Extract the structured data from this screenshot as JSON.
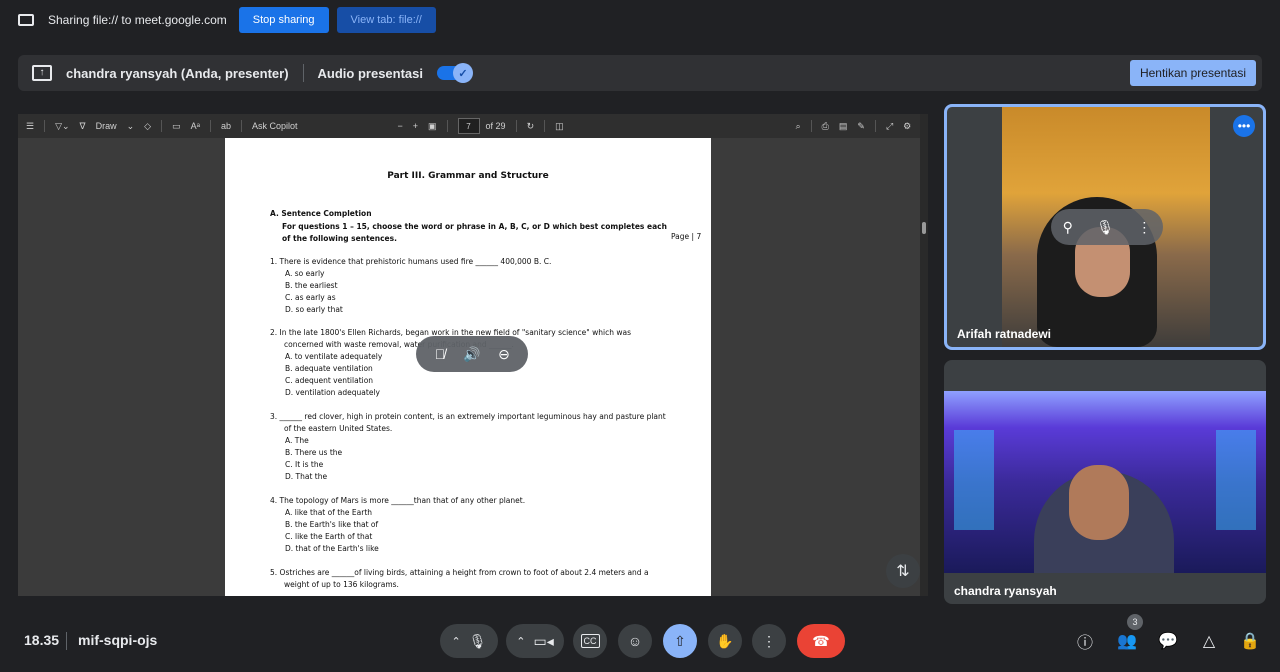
{
  "share_bar": {
    "text": "Sharing file:// to meet.google.com",
    "stop_label": "Stop sharing",
    "view_label": "View tab: file://"
  },
  "presenter_bar": {
    "presenter": "chandra ryansyah (Anda, presenter)",
    "audio_label": "Audio presentasi",
    "audio_on": true,
    "stop_label": "Hentikan presentasi"
  },
  "pdf_toolbar": {
    "draw_label": "Draw",
    "copilot_label": "Ask Copilot",
    "page_current": "7",
    "page_total": "of 29"
  },
  "pdf": {
    "part_title": "Part III.  Grammar and Structure",
    "section_title": "A. Sentence Completion",
    "instruction": "For questions 1 – 15, choose the word or phrase in A, B, C, or D which best completes each of the following sentences.",
    "page_label": "Page | 7",
    "questions": [
      {
        "stem": "1.  There is evidence that prehistoric humans used fire ______ 400,000 B. C.",
        "options": [
          "A.   so early",
          "B.   the earliest",
          "C.   as early as",
          "D.   so early that"
        ]
      },
      {
        "stem": "2.  In the late 1800's Ellen Richards, began work in the new field of \"sanitary science\" which was concerned with waste removal, water purification and ______.",
        "options": [
          "A.   to ventilate adequately",
          "B.   adequate ventilation",
          "C.   adequent ventilation",
          "D.   ventilation adequately"
        ]
      },
      {
        "stem": "3.  ______ red clover, high in protein content, is an extremely important leguminous hay and pasture plant of the eastern United States.",
        "options": [
          "A.   The",
          "B.   There us the",
          "C.   It is the",
          "D.   That the"
        ]
      },
      {
        "stem": "4.  The topology of Mars is more ______than that of any other planet.",
        "options": [
          "A.   like that of the Earth",
          "B.   the Earth's like that of",
          "C.   like the Earth of that",
          "D.   that of the Earth's like"
        ]
      },
      {
        "stem": "5.  Ostriches are ______of living birds, attaining a height from crown to foot of about 2.4 meters and a weight of up to 136 kilograms.",
        "options": []
      }
    ]
  },
  "participants": [
    {
      "name": "Arifah ratnadewi"
    },
    {
      "name": "chandra ryansyah"
    }
  ],
  "bottom_bar": {
    "clock": "18.35",
    "meeting_code": "mif-sqpi-ojs",
    "participant_count": "3"
  },
  "colors": {
    "accent": "#8ab4f8",
    "primary": "#1a73e8",
    "hangup": "#ea4335",
    "background": "#202124"
  }
}
